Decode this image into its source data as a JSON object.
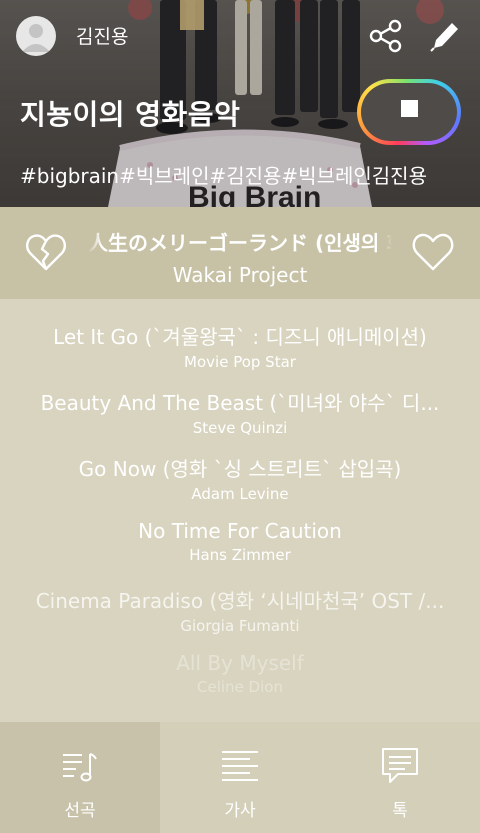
{
  "header": {
    "owner_name": "김진용",
    "playlist_title": "지뇽이의 영화음악",
    "hashtags": "#bigbrain#빅브레인#김진용#빅브레인김진용",
    "cake_text": "Big Brain"
  },
  "now_playing": {
    "title": "人生のメリーゴーランド (인생의 회전목마)",
    "artist": "Wakai Project"
  },
  "queue": [
    {
      "title": "Let It Go (`겨울왕국` : 디즈니 애니메이션)",
      "artist": "Movie Pop Star",
      "opacity": 1.0
    },
    {
      "title": "Beauty And The Beast (`미녀와 야수` 디...",
      "artist": "Steve Quinzi",
      "opacity": 1.0
    },
    {
      "title": "Go Now (영화 `싱 스트리트` 삽입곡)",
      "artist": "Adam Levine",
      "opacity": 1.0
    },
    {
      "title": "No Time For Caution",
      "artist": "Hans Zimmer",
      "opacity": 1.0
    },
    {
      "title": "Cinema Paradiso (영화 ‘시네마천국’ OST /...",
      "artist": "Giorgia Fumanti",
      "opacity": 0.75
    },
    {
      "title": "All By Myself",
      "artist": "Celine Dion",
      "opacity": 0.35
    }
  ],
  "tabs": [
    {
      "label": "선곡",
      "icon": "music-list-icon",
      "active": true
    },
    {
      "label": "가사",
      "icon": "lyrics-icon",
      "active": false
    },
    {
      "label": "톡",
      "icon": "chat-icon",
      "active": false
    }
  ],
  "colors": {
    "accent_ring": "rainbow",
    "queue_bg": "#d8d4bf",
    "now_playing_bg": "#c7c2a6"
  }
}
